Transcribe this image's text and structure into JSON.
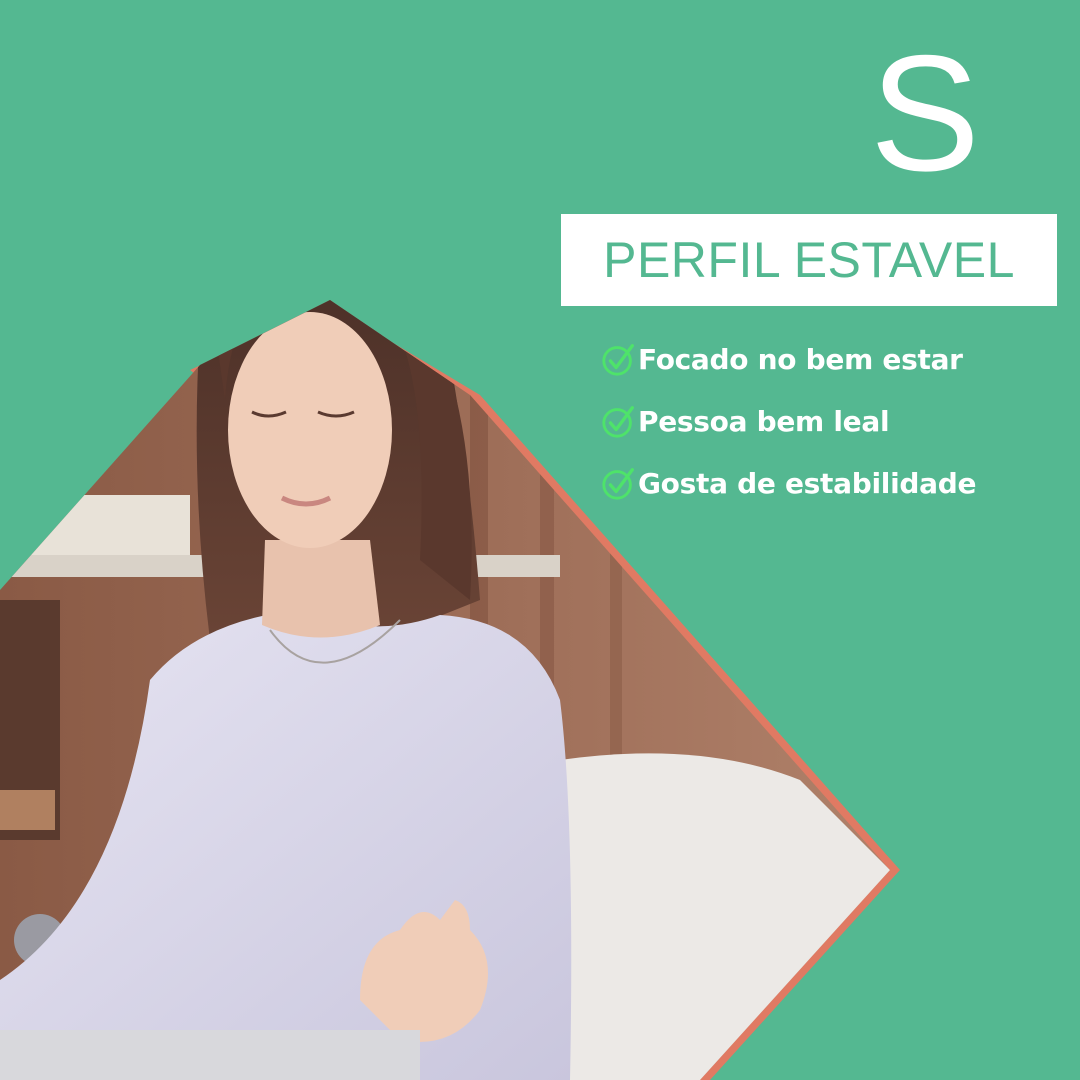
{
  "hero": {
    "letter": "S",
    "title": "PERFIL ESTAVEL"
  },
  "traits": [
    {
      "label": "Focado no bem estar",
      "icon": "check-circle-icon"
    },
    {
      "label": "Pessoa bem leal",
      "icon": "check-circle-icon"
    },
    {
      "label": "Gosta de estabilidade",
      "icon": "check-circle-icon"
    }
  ],
  "colors": {
    "background": "#54b891",
    "title_box": "#ffffff",
    "title_text": "#54b891",
    "check": "#4ee36a",
    "accent_edge": "#e07a63"
  }
}
